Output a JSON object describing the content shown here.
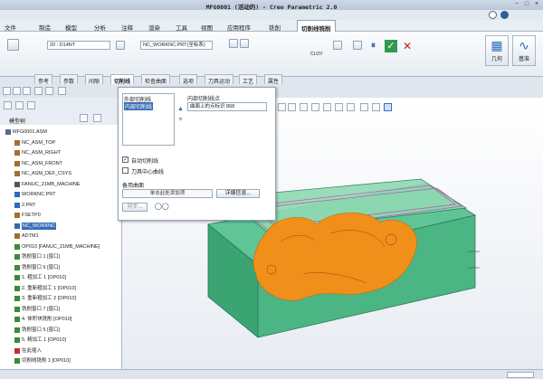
{
  "window": {
    "title": "MFG0001 (活动的) - Creo Parametric 2.0"
  },
  "menu": {
    "file": "文件",
    "tabs": [
      "制造",
      "模型",
      "分析",
      "注释",
      "渲染",
      "工具",
      "视图",
      "应用程序",
      "铣削"
    ],
    "active_tab": "切削线铣削"
  },
  "ribbon": {
    "tool_select": "20 : D14NT",
    "coordinate_label": "NC_WORKNC.PRT(坐标系)",
    "param_label": "CLOY",
    "geometry": "几何",
    "datum": "基准"
  },
  "subtabs": [
    "参考",
    "参数",
    "间隙",
    "切削线",
    "检查曲面",
    "选项",
    "刀具运动",
    "工艺",
    "属性"
  ],
  "active_subtab": "切削线",
  "dialog": {
    "list": [
      "外部切削线",
      "内部切削线"
    ],
    "selected_index": 1,
    "inner_point_label": "内部切削线点",
    "inner_point_value": "曲面上的点标识 868",
    "auto_cutline": "自动切削线",
    "tool_center": "刀具中心曲线",
    "backup_surface": "备用曲面",
    "click_to_add": "单击此处添加项",
    "details": "详细信息...",
    "sync": "同步..."
  },
  "tree": {
    "header": "模型树",
    "items": [
      {
        "label": "MFG0001.ASM",
        "indent": 0,
        "color": "#5a6b8a"
      },
      {
        "label": "NC_ASM_TOP",
        "indent": 1,
        "color": "#a07030"
      },
      {
        "label": "NC_ASM_RIGHT",
        "indent": 1,
        "color": "#a07030"
      },
      {
        "label": "NC_ASM_FRONT",
        "indent": 1,
        "color": "#a07030"
      },
      {
        "label": "NC_ASM_DEF_CSYS",
        "indent": 1,
        "color": "#a07030"
      },
      {
        "label": "FANUC_21MB_MACHINE",
        "indent": 1,
        "color": "#556"
      },
      {
        "label": "WORKNC.PRT",
        "indent": 1,
        "color": "#2d6bb5"
      },
      {
        "label": "2.PRT",
        "indent": 1,
        "color": "#2d6bb5"
      },
      {
        "label": "FSETP0",
        "indent": 1,
        "color": "#a07030"
      },
      {
        "label": "NC_WORKNC",
        "indent": 1,
        "color": "#2d6bb5",
        "selected": true
      },
      {
        "label": "ADTM1",
        "indent": 1,
        "color": "#a07030"
      },
      {
        "label": "OP010 [FANUC_21MB_MACHINE]",
        "indent": 1,
        "color": "#3a8a3a"
      },
      {
        "label": "铣削窗口 1 [窗口]",
        "indent": 1,
        "color": "#3a8a3a"
      },
      {
        "label": "铣削窗口 6 [窗口]",
        "indent": 1,
        "color": "#3a8a3a"
      },
      {
        "label": "1. 粗加工 1 [OP010]",
        "indent": 1,
        "color": "#3a8a3a"
      },
      {
        "label": "2. 重新粗加工 1 [OP010]",
        "indent": 1,
        "color": "#3a8a3a"
      },
      {
        "label": "3. 重新粗加工 2 [OP010]",
        "indent": 1,
        "color": "#3a8a3a"
      },
      {
        "label": "铣削窗口 7 [窗口]",
        "indent": 1,
        "color": "#3a8a3a"
      },
      {
        "label": "4. 体积块铣削 [OP010]",
        "indent": 1,
        "color": "#3a8a3a"
      },
      {
        "label": "铣削窗口 5 [窗口]",
        "indent": 1,
        "color": "#3a8a3a"
      },
      {
        "label": "5. 精加工 1 [OP010]",
        "indent": 1,
        "color": "#3a8a3a"
      },
      {
        "label": "在此插入",
        "indent": 1,
        "color": "#c03030"
      },
      {
        "label": "切削线铣削 1 [OP010]",
        "indent": 1,
        "color": "#3a8a3a"
      }
    ]
  },
  "colors": {
    "accent": "#3a6db5",
    "part_green": "#3bb07a",
    "toolpath_orange": "#f0901a"
  }
}
